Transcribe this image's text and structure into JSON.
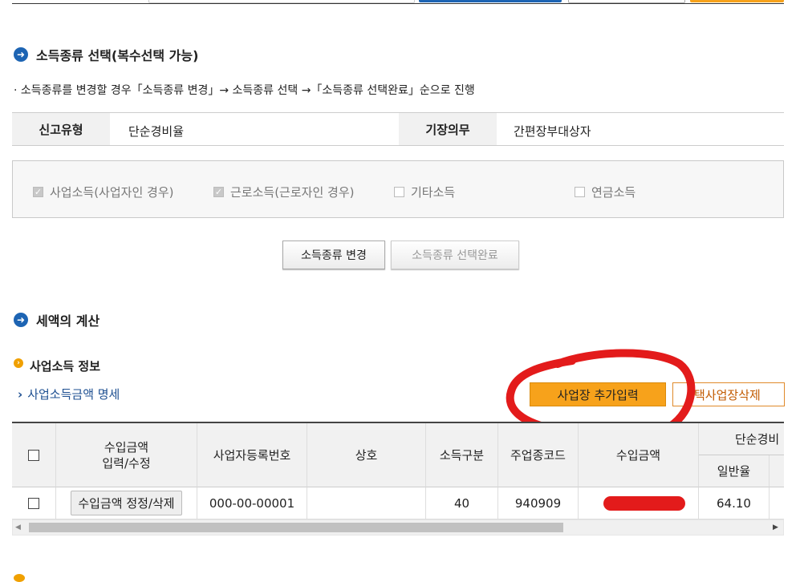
{
  "section_income_type": {
    "title": "소득종류 선택(복수선택 가능)",
    "instruction": "· 소득종류를 변경할 경우「소득종류 변경」→ 소득종류 선택 →「소득종류 선택완료」순으로 진행",
    "info": {
      "report_type_label": "신고유형",
      "report_type_value": "단순경비율",
      "bookkeeping_label": "기장의무",
      "bookkeeping_value": "간편장부대상자"
    },
    "checkboxes": [
      {
        "label": "사업소득(사업자인 경우)",
        "checked": true
      },
      {
        "label": "근로소득(근로자인 경우)",
        "checked": true
      },
      {
        "label": "기타소득",
        "checked": false
      },
      {
        "label": "연금소득",
        "checked": false
      }
    ],
    "change_button": "소득종류 변경",
    "complete_button": "소득종류 선택완료"
  },
  "section_tax_calc": {
    "title": "세액의 계산",
    "business_info_title": "사업소득 정보",
    "business_amount_link": "사업소득금액 명세",
    "add_business_button": "사업장 추가입력",
    "delete_business_button": "택사업장삭제",
    "table": {
      "headers": {
        "amount_edit_line1": "수입금액",
        "amount_edit_line2": "입력/수정",
        "biz_reg_no": "사업자등록번호",
        "trade_name": "상호",
        "income_class": "소득구분",
        "main_industry_code": "주업종코드",
        "revenue": "수입금액",
        "simple_expense_group": "단순경비",
        "general_rate": "일반율"
      },
      "rows": [
        {
          "edit_button": "수입금액 정정/삭제",
          "biz_reg_no": "000-00-00001",
          "trade_name": "",
          "income_class": "40",
          "main_industry_code": "940909",
          "revenue": "",
          "general_rate": "64.10"
        }
      ]
    }
  },
  "colors": {
    "accent_blue": "#1d64b3",
    "add_button": "#f7a21b",
    "annotation_red": "#e31b1b"
  }
}
